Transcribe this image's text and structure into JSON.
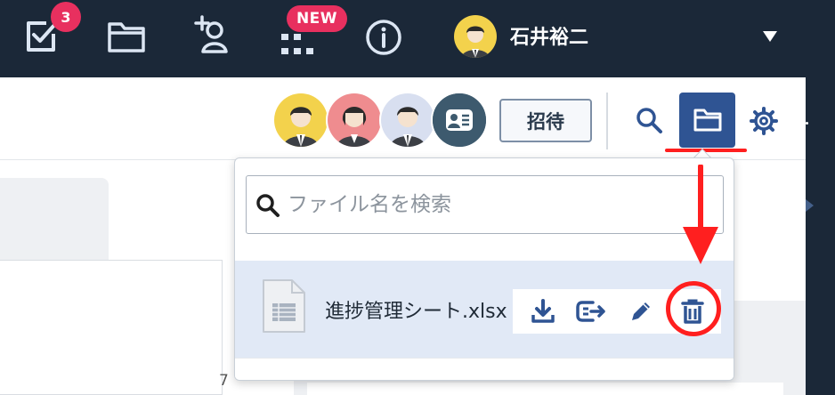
{
  "topbar": {
    "tasks_badge": "3",
    "new_badge": "NEW",
    "user_name": "石井裕二",
    "icons": [
      "tasks-checkbox-icon",
      "folder-icon",
      "add-contact-icon",
      "app-grid-icon",
      "info-icon",
      "chevron-down-icon"
    ]
  },
  "toolbar": {
    "members": [
      "member-avatar-1",
      "member-avatar-2",
      "member-avatar-3",
      "member-avatar-contact"
    ],
    "invite_label": "招待",
    "icons": [
      "search-icon",
      "folder-icon",
      "gear-icon"
    ]
  },
  "file_popover": {
    "search_placeholder": "ファイル名を検索",
    "files": [
      {
        "name": "進捗管理シート.xlsx",
        "icon": "spreadsheet-file-icon",
        "actions": [
          "download-icon",
          "share-icon",
          "edit-icon",
          "trash-icon"
        ]
      }
    ]
  },
  "background": {
    "stray_text": "7"
  },
  "colors": {
    "topbar_bg": "#1b2838",
    "badge": "#e8305f",
    "accent": "#2f5493",
    "annotation_red": "#ff1f1f",
    "row_highlight": "#e1e9f6"
  }
}
